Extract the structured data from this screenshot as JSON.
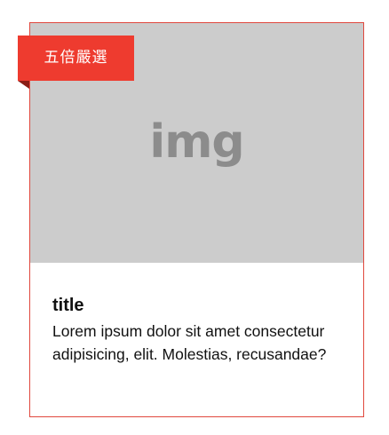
{
  "card": {
    "badge_label": "五倍嚴選",
    "image_placeholder": "img",
    "title": "title",
    "description": "Lorem ipsum dolor sit amet consectetur adipisicing, elit. Molestias, recusandae?"
  },
  "colors": {
    "badge": "#ee3b2f",
    "badge_fold": "#8a1d15",
    "card_border": "#e0483e",
    "image_background": "#cccccc",
    "image_text": "#8c8c8c"
  }
}
